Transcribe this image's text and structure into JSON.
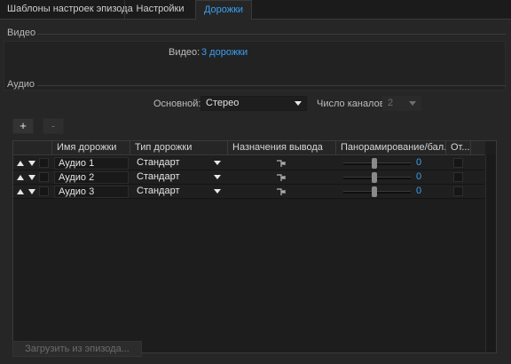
{
  "tabs": [
    {
      "label": "Шаблоны настроек эпизода",
      "active": false
    },
    {
      "label": "Настройки",
      "active": false
    },
    {
      "label": "Дорожки",
      "active": true
    }
  ],
  "video": {
    "section_title": "Видео",
    "label": "Видео:",
    "value": "3 дорожки"
  },
  "audio": {
    "section_title": "Аудио",
    "master_label": "Основной:",
    "master_value": "Стерео",
    "channels_label": "Число каналов:",
    "channels_value": "2",
    "add_label": "+",
    "remove_label": "-"
  },
  "table": {
    "columns": [
      "Имя дорожки",
      "Тип дорожки",
      "Назначения вывода",
      "Панорамирование/бал...",
      "От..."
    ],
    "rows": [
      {
        "name": "Аудио 1",
        "type": "Стандарт",
        "pan": "0",
        "pan_position": 0.5
      },
      {
        "name": "Аудио 2",
        "type": "Стандарт",
        "pan": "0",
        "pan_position": 0.5
      },
      {
        "name": "Аудио 3",
        "type": "Стандарт",
        "pan": "0",
        "pan_position": 0.5
      }
    ]
  },
  "footer": {
    "load_label": "Загрузить из эпизода..."
  },
  "colors": {
    "accent": "#3aa0f2",
    "background": "#262626"
  }
}
